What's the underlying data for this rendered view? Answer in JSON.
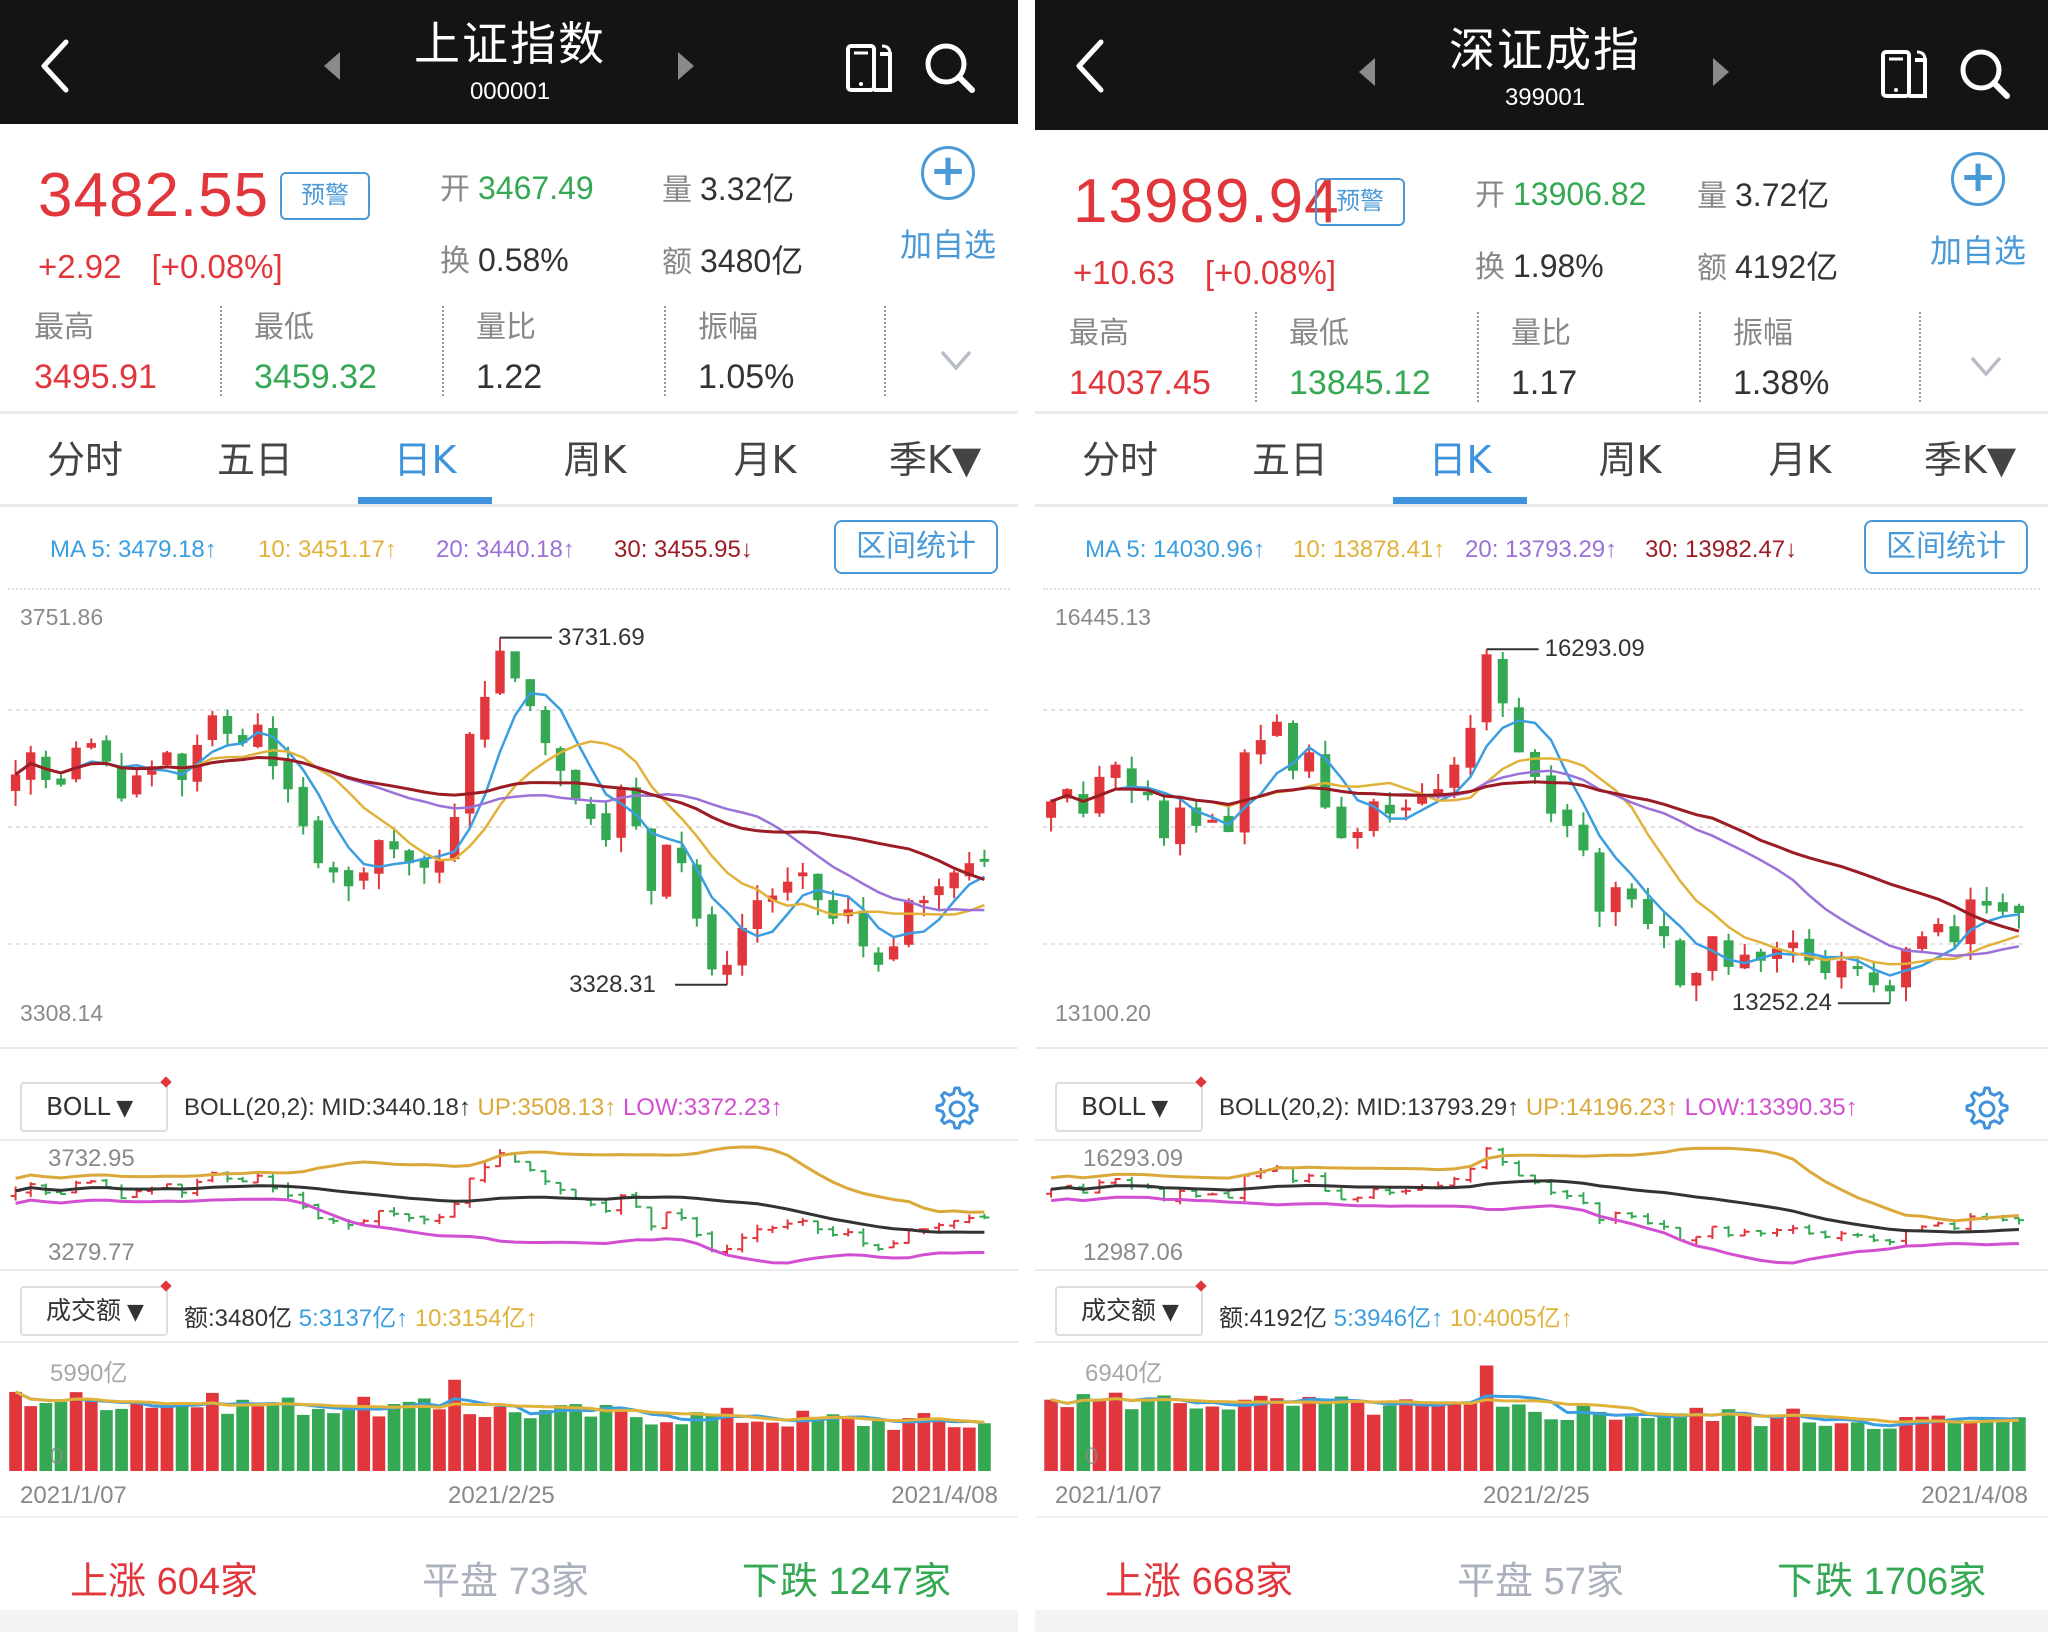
{
  "colors": {
    "up": "#e0363c",
    "down": "#34a853",
    "accent": "#3f92dc",
    "ma5": "#3a9ee0",
    "ma10": "#e0b23a",
    "ma20": "#9a72d8",
    "ma30": "#9b1c24",
    "boll_mid": "#333333",
    "boll_up": "#dba83a",
    "boll_low": "#d34fd1",
    "flat": "#aab1bd"
  },
  "panels": [
    {
      "header": {
        "title": "上证指数",
        "code": "000001",
        "back_icon": "chevron-left-icon",
        "prev_icon": "triangle-left-icon",
        "next_icon": "triangle-right-icon",
        "switch_icon": "landscape-switch-icon",
        "search_icon": "search-icon"
      },
      "quote": {
        "price": "3482.55",
        "alert_label": "预警",
        "change": "+2.92",
        "change_pct": "[+0.08%]",
        "open_label": "开",
        "open": "3467.49",
        "volume_label": "量",
        "volume": "3.32亿",
        "turnover_label": "换",
        "turnover": "0.58%",
        "amount_label": "额",
        "amount": "3480亿",
        "add_fav_label": "加自选",
        "high_label": "最高",
        "high": "3495.91",
        "low_label": "最低",
        "low": "3459.32",
        "vol_ratio_label": "量比",
        "vol_ratio": "1.22",
        "amplitude_label": "振幅",
        "amplitude": "1.05%"
      },
      "tabs": [
        {
          "label": "分时",
          "active": false
        },
        {
          "label": "五日",
          "active": false
        },
        {
          "label": "日K",
          "active": true
        },
        {
          "label": "周K",
          "active": false
        },
        {
          "label": "月K",
          "active": false
        },
        {
          "label": "季K▼",
          "active": false
        }
      ],
      "ma": {
        "ma5": "MA 5: 3479.18↑",
        "ma10": "10: 3451.17↑",
        "ma20": "20: 3440.18↑",
        "ma30": "30: 3455.95↓",
        "range_label": "区间统计"
      },
      "kline": {
        "y_max_label": "3751.86",
        "y_min_label": "3308.14",
        "peak_label": "3731.69",
        "trough_label": "3328.31"
      },
      "boll": {
        "selector": "BOLL",
        "params": "BOLL(20,2):",
        "mid": "MID:3440.18↑",
        "up": "UP:3508.13↑",
        "low": "LOW:3372.23↑",
        "y_max_label": "3732.95",
        "y_min_label": "3279.77"
      },
      "amount_ind": {
        "selector": "成交额",
        "value": "额:3480亿",
        "ma5": "5:3137亿↑",
        "ma10": "10:3154亿↑",
        "y_max_label": "5990亿",
        "y_min_label": "0"
      },
      "dates": [
        "2021/1/07",
        "2021/2/25",
        "2021/4/08"
      ],
      "breadth": {
        "up_label": "上涨",
        "up": "604家",
        "flat_label": "平盘",
        "flat": "73家",
        "down_label": "下跌",
        "down": "1247家"
      }
    },
    {
      "header": {
        "title": "深证成指",
        "code": "399001",
        "back_icon": "chevron-left-icon",
        "prev_icon": "triangle-left-icon",
        "next_icon": "triangle-right-icon",
        "switch_icon": "landscape-switch-icon",
        "search_icon": "search-icon"
      },
      "quote": {
        "price": "13989.94",
        "alert_label": "预警",
        "change": "+10.63",
        "change_pct": "[+0.08%]",
        "open_label": "开",
        "open": "13906.82",
        "volume_label": "量",
        "volume": "3.72亿",
        "turnover_label": "换",
        "turnover": "1.98%",
        "amount_label": "额",
        "amount": "4192亿",
        "add_fav_label": "加自选",
        "high_label": "最高",
        "high": "14037.45",
        "low_label": "最低",
        "low": "13845.12",
        "vol_ratio_label": "量比",
        "vol_ratio": "1.17",
        "amplitude_label": "振幅",
        "amplitude": "1.38%"
      },
      "tabs": [
        {
          "label": "分时",
          "active": false
        },
        {
          "label": "五日",
          "active": false
        },
        {
          "label": "日K",
          "active": true
        },
        {
          "label": "周K",
          "active": false
        },
        {
          "label": "月K",
          "active": false
        },
        {
          "label": "季K▼",
          "active": false
        }
      ],
      "ma": {
        "ma5": "MA 5: 14030.96↑",
        "ma10": "10: 13878.41↑",
        "ma20": "20: 13793.29↑",
        "ma30": "30: 13982.47↓",
        "range_label": "区间统计"
      },
      "kline": {
        "y_max_label": "16445.13",
        "y_min_label": "13100.20",
        "peak_label": "16293.09",
        "trough_label": "13252.24"
      },
      "boll": {
        "selector": "BOLL",
        "params": "BOLL(20,2):",
        "mid": "MID:13793.29↑",
        "up": "UP:14196.23↑",
        "low": "LOW:13390.35↑",
        "y_max_label": "16293.09",
        "y_min_label": "12987.06"
      },
      "amount_ind": {
        "selector": "成交额",
        "value": "额:4192亿",
        "ma5": "5:3946亿↑",
        "ma10": "10:4005亿↑",
        "y_max_label": "6940亿",
        "y_min_label": "0"
      },
      "dates": [
        "2021/1/07",
        "2021/2/25",
        "2021/4/08"
      ],
      "breadth": {
        "up_label": "上涨",
        "up": "668家",
        "flat_label": "平盘",
        "flat": "57家",
        "down_label": "下跌",
        "down": "1706家"
      }
    }
  ],
  "chart_data": [
    {
      "type": "candlestick",
      "title": "上证指数 日K",
      "x_range": [
        "2021/1/07",
        "2021/4/08"
      ],
      "ylim": [
        3308.14,
        3751.86
      ],
      "annotations": {
        "high": 3731.69,
        "low": 3328.31
      },
      "ohlc_closes": [
        3576,
        3600,
        3570,
        3565,
        3605,
        3610,
        3590,
        3550,
        3575,
        3585,
        3600,
        3570,
        3608,
        3640,
        3620,
        3610,
        3630,
        3585,
        3560,
        3520,
        3480,
        3470,
        3455,
        3470,
        3505,
        3495,
        3480,
        3475,
        3483,
        3530,
        3620,
        3660,
        3710,
        3680,
        3650,
        3610,
        3580,
        3550,
        3528,
        3505,
        3560,
        3520,
        3450,
        3500,
        3480,
        3420,
        3365,
        3370,
        3410,
        3440,
        3445,
        3460,
        3470,
        3440,
        3420,
        3430,
        3390,
        3370,
        3390,
        3440,
        3440,
        3455,
        3470,
        3480,
        3482
      ],
      "boll_mid_last": 3440.18,
      "boll_up_last": 3508.13,
      "boll_low_last": 3372.23,
      "amount_ylim": [
        0,
        5990
      ]
    },
    {
      "type": "candlestick",
      "title": "深证成指 日K",
      "x_range": [
        "2021/1/07",
        "2021/4/08"
      ],
      "ylim": [
        13100.2,
        16445.13
      ],
      "annotations": {
        "high": 16293.09,
        "low": 13252.24
      },
      "ohlc_closes": [
        14900,
        15000,
        14800,
        15100,
        15200,
        15000,
        14950,
        14600,
        14850,
        14700,
        14750,
        14650,
        15300,
        15400,
        15550,
        15150,
        15300,
        14850,
        14600,
        14650,
        14900,
        14800,
        14850,
        14950,
        15000,
        15200,
        15500,
        16100,
        15700,
        15300,
        15100,
        14800,
        14700,
        14500,
        14000,
        14200,
        14100,
        13900,
        13800,
        13400,
        13500,
        13800,
        13550,
        13650,
        13600,
        13700,
        13750,
        13600,
        13500,
        13600,
        13550,
        13400,
        13350,
        13700,
        13800,
        13900,
        13750,
        14100,
        14050,
        14000,
        13990
      ],
      "boll_mid_last": 13793.29,
      "boll_up_last": 14196.23,
      "boll_low_last": 13390.35,
      "amount_ylim": [
        0,
        6940
      ]
    }
  ]
}
